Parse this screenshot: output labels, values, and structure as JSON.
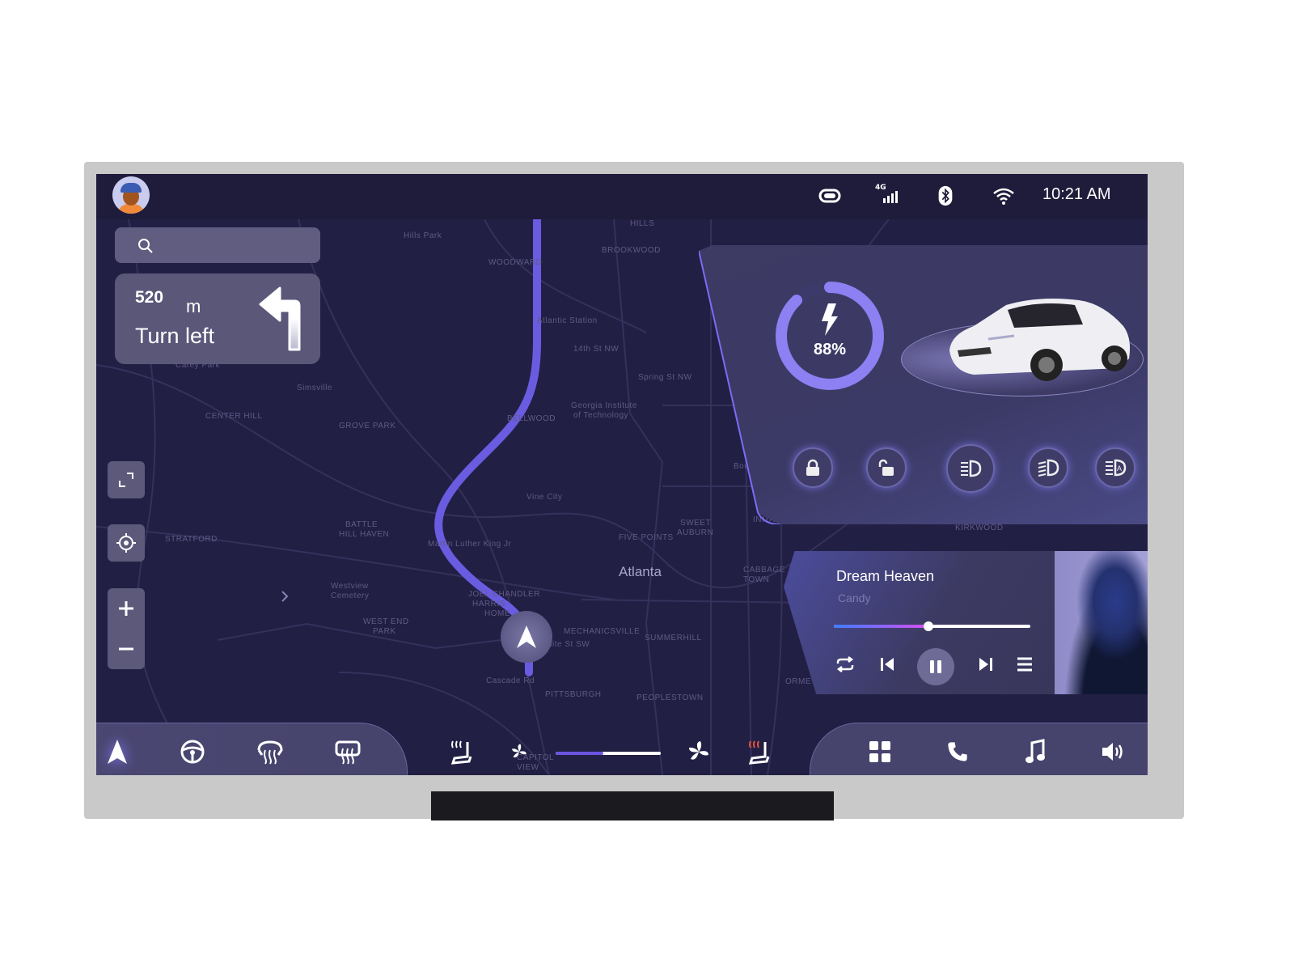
{
  "status_bar": {
    "time": "10:21 AM",
    "network": "4G",
    "icons": [
      "avatar",
      "toggle-icon",
      "signal-4g-icon",
      "bluetooth-icon",
      "wifi-icon"
    ]
  },
  "search": {
    "placeholder": "",
    "icon": "search-icon"
  },
  "navigation": {
    "distance": "520",
    "unit": "m",
    "instruction": "Turn left",
    "icon": "turn-left-arrow-icon"
  },
  "map": {
    "city_label": "Atlanta",
    "labels": [
      "Hills Park",
      "WOODWARD",
      "BROOKWOOD",
      "HILLS",
      "Atlantic Station",
      "14th St NW",
      "Georgia Institute",
      "of Technology",
      "BELLWOOD",
      "GROVE PARK",
      "CENTER HILL",
      "Simsville",
      "Carey Park",
      "Spring St NW",
      "Vine City",
      "BATTLE",
      "HILL HAVEN",
      "Martin Luther King Jr",
      "STRATFORD",
      "Westview",
      "Cemetery",
      "WEST END",
      "PARK",
      "JOEL CHANDLER",
      "HARRIS",
      "HOME",
      "MECHANICSVILLE",
      "SUMMERHILL",
      "FIVE POINTS",
      "SWEET",
      "AUBURN",
      "PITTSBURGH",
      "PEOPLESTOWN",
      "White St SW",
      "Cascade Rd",
      "INMAN",
      "CABBAGE",
      "TOWN",
      "KIRKWOOD",
      "ORMEWOOD",
      "CAPITOL",
      "VIEW",
      "Boulevard NE"
    ],
    "controls": [
      "fullscreen-button",
      "locate-button",
      "zoom-in-button",
      "zoom-out-button"
    ]
  },
  "vehicle": {
    "battery_percent": "88%",
    "battery_level": 88,
    "buttons": [
      "lock",
      "unlock",
      "low-beam",
      "high-beam",
      "auto-headlight"
    ]
  },
  "player": {
    "title": "Dream Heaven",
    "artist": "Candy",
    "progress": 0.48,
    "controls": [
      "repeat",
      "previous",
      "pause",
      "next",
      "playlist"
    ]
  },
  "dock": {
    "left": [
      "navigation",
      "steering-wheel-heat",
      "front-defrost",
      "rear-defrost"
    ],
    "climate": {
      "fan_level": 0.45,
      "items": [
        "driver-seat-heat",
        "fan-low",
        "fan-high",
        "passenger-seat-heat"
      ]
    },
    "right": [
      "apps",
      "phone",
      "music",
      "volume"
    ]
  },
  "colors": {
    "accent": "#7a6cf0",
    "background": "#221f44",
    "seat_heat_active": "#e8553a"
  }
}
